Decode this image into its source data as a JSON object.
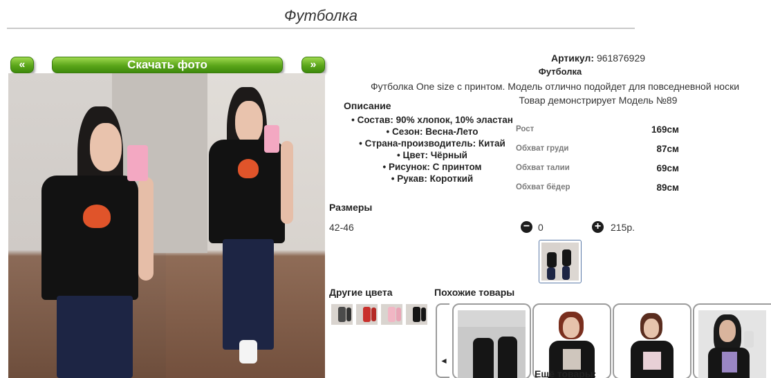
{
  "page": {
    "title": "Футболка"
  },
  "gallery": {
    "prev_label": "«",
    "next_label": "»",
    "download_label": "Скачать фото"
  },
  "product": {
    "article_label": "Артикул:",
    "article_value": "961876929",
    "name": "Футболка",
    "description": "Футболка One size с принтом. Модель отлично подойдет для повседневной носки",
    "model_line": "Товар демонстрирует Модель №89"
  },
  "description": {
    "title": "Описание",
    "items": [
      "Состав: 90% хлопок, 10% эластан",
      "Сезон: Весна-Лето",
      "Страна-производитель: Китай",
      "Цвет: Чёрный",
      "Рисунок: С принтом",
      "Рукав: Короткий"
    ]
  },
  "measurements": [
    {
      "label": "Рост",
      "value": "169см"
    },
    {
      "label": "Обхват груди",
      "value": "87см"
    },
    {
      "label": "Обхват талии",
      "value": "69см"
    },
    {
      "label": "Обхват бёдер",
      "value": "89см"
    }
  ],
  "sizes": {
    "title": "Размеры",
    "size": "42-46",
    "minus_label": "−",
    "plus_label": "+",
    "quantity": "0",
    "price": "215р."
  },
  "other_colors": {
    "title": "Другие цвета",
    "swatches": [
      "black-gray",
      "red",
      "pink",
      "black"
    ]
  },
  "similar": {
    "title": "Похожие товары",
    "arrow_label": "◄",
    "more_label": "Ещё товары:"
  },
  "colors": {
    "button_green": "#5aa51a",
    "shirt_black": "#121212",
    "jeans_navy": "#1d2544",
    "thumb_border": "#5b7aa7",
    "card_border": "#9b9b9b"
  },
  "icons": {
    "minus": "minus-circle-icon",
    "plus": "plus-circle-icon"
  }
}
